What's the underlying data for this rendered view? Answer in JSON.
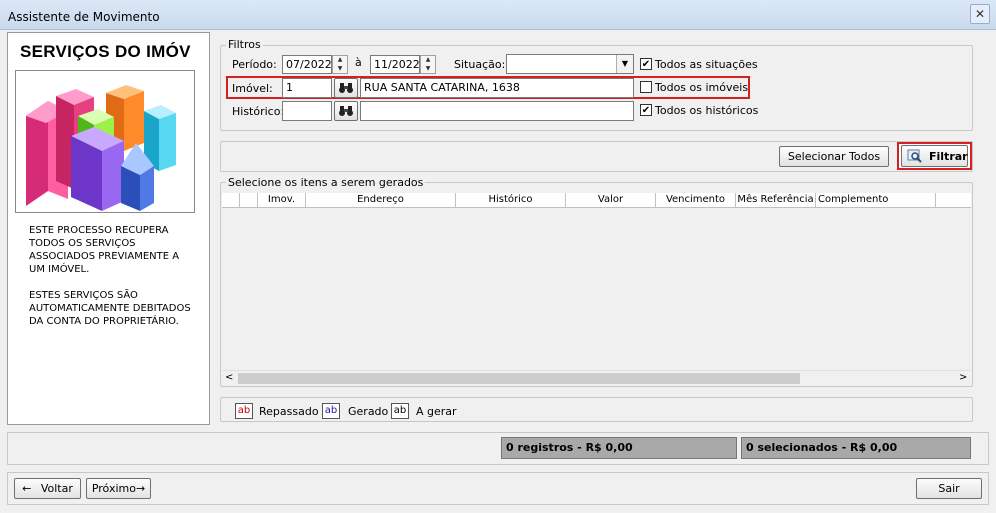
{
  "window": {
    "title": "Assistente de Movimento",
    "close_glyph": "✕"
  },
  "side": {
    "title": "SERVIÇOS DO IMÓV",
    "desc1": "ESTE PROCESSO RECUPERA\nTODOS OS SERVIÇOS\nASSOCIADOS PREVIAMENTE A\nUM IMÓVEL.",
    "desc2": "ESTES SERVIÇOS SÃO\nAUTOMATICAMENTE DEBITADOS\nDA CONTA DO PROPRIETÁRIO."
  },
  "filters": {
    "legend": "Filtros",
    "periodo_label": "Período:",
    "periodo_from": "07/2022",
    "periodo_sep": "à",
    "periodo_to": "11/2022",
    "situacao_label": "Situação:",
    "situacao_value": "",
    "todas_situacoes": "Todos as situações",
    "todas_situacoes_checked": true,
    "imovel_label": "Imóvel:",
    "imovel_code": "1",
    "imovel_address": "RUA SANTA CATARINA, 1638",
    "todos_imoveis": "Todos os imóveis",
    "todos_imoveis_checked": false,
    "historico_label": "Histórico:",
    "historico_code": "",
    "historico_desc": "",
    "todos_historicos": "Todos os históricos",
    "todos_historicos_checked": true
  },
  "actions": {
    "selecionar_todos": "Selecionar Todos",
    "filtrar": "Filtrar"
  },
  "grid": {
    "legend": "Selecione os itens a serem gerados",
    "columns": [
      "",
      "",
      "Imov.",
      "Endereço",
      "Histórico",
      "Valor",
      "Vencimento",
      "Mês Referência",
      "Complemento"
    ],
    "rows": []
  },
  "legend_items": [
    {
      "glyph": "ab",
      "label": "Repassado",
      "color": "#cc0000"
    },
    {
      "glyph": "ab",
      "label": "Gerado",
      "color": "#1a1aa6"
    },
    {
      "glyph": "ab",
      "label": "A gerar",
      "color": "#000000"
    }
  ],
  "status": {
    "registros": "0 registros - R$ 0,00",
    "selecionados": "0 selecionados - R$ 0,00"
  },
  "footer": {
    "voltar": "Voltar",
    "proximo": "Próximo",
    "sair": "Sair"
  },
  "icons": {
    "binoculars": "binoculars-icon",
    "arrow_left": "←",
    "arrow_right": "→"
  }
}
